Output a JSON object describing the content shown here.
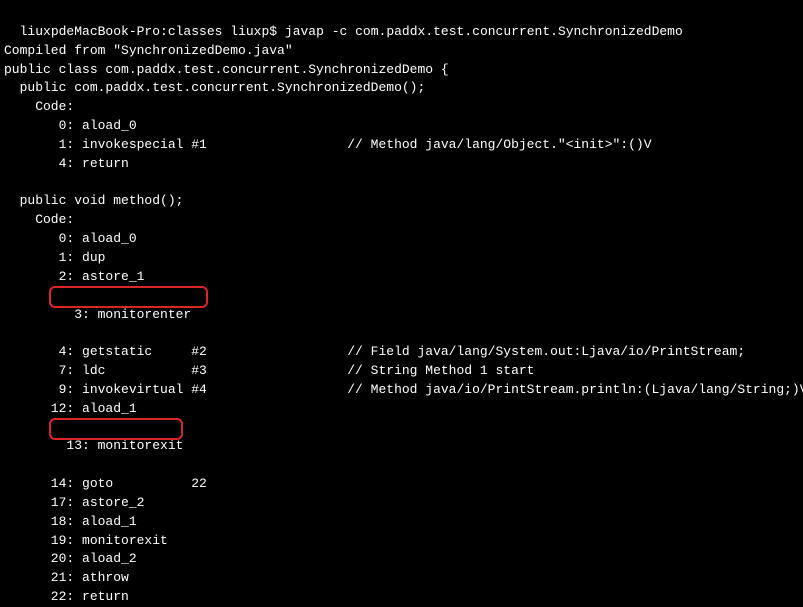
{
  "prompt": {
    "host_path": "liuxpdeMacBook-Pro:classes",
    "user": "liuxp",
    "dollar": "$",
    "command": "javap -c com.paddx.test.concurrent.SynchronizedDemo"
  },
  "compiled_from": "Compiled from \"SynchronizedDemo.java\"",
  "class_decl": "public class com.paddx.test.concurrent.SynchronizedDemo {",
  "ctor_sig": "  public com.paddx.test.concurrent.SynchronizedDemo();",
  "code_label": "    Code:",
  "ctor": {
    "l0": "       0: aload_0",
    "l1": "       1: invokespecial #1                  // Method java/lang/Object.\"<init>\":()V",
    "l4": "       4: return"
  },
  "method_sig": "  public void method();",
  "method_code_label": "    Code:",
  "m": {
    "l0": "       0: aload_0",
    "l1": "       1: dup",
    "l2": "       2: astore_1",
    "l3": "       3: monitorenter",
    "l4": "       4: getstatic     #2                  // Field java/lang/System.out:Ljava/io/PrintStream;",
    "l7": "       7: ldc           #3                  // String Method 1 start",
    "l9": "       9: invokevirtual #4                  // Method java/io/PrintStream.println:(Ljava/lang/String;)V",
    "l12": "      12: aload_1",
    "l13": "      13: monitorexit",
    "l14": "      14: goto          22",
    "l17": "      17: astore_2",
    "l18": "      18: aload_1",
    "l19": "      19: monitorexit",
    "l20": "      20: aload_2",
    "l21": "      21: athrow",
    "l22": "      22: return"
  },
  "highlights": {
    "monitorenter_note": "monitorenter instruction highlighted",
    "monitorexit_note": "monitorexit instruction highlighted"
  }
}
